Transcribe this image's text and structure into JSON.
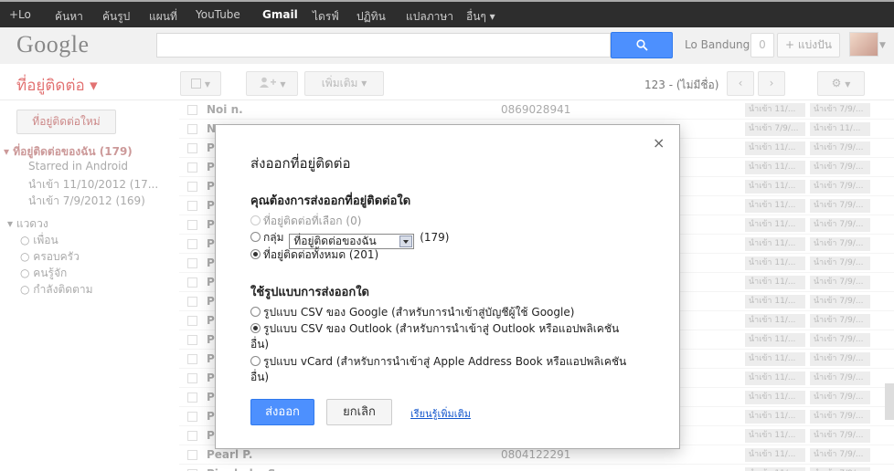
{
  "topbar": {
    "items": [
      "+Lo",
      "ค้นหา",
      "ค้นรูป",
      "แผนที่",
      "YouTube",
      "Gmail",
      "ไดรฟ์",
      "ปฏิทิน",
      "แปลภาษา",
      "อื่นๆ ▾"
    ],
    "active_index": 5
  },
  "header": {
    "logo": "Google",
    "user_name": "Lo Bandung",
    "notification_count": "0",
    "share_label": "+ แบ่งปัน"
  },
  "toolbar": {
    "title": "ที่อยู่ติดต่อ ▾",
    "more_label": "เพิ่มเติม ▾",
    "page_info": "123 - (ไม่มีชื่อ)"
  },
  "sidebar": {
    "new_contact": "ที่อยู่ติดต่อใหม่",
    "my_contacts": "▾ ที่อยู่ติดต่อของฉัน (179)",
    "sub_items": [
      "Starred in Android",
      "นำเข้า 11/10/2012 (17...",
      "นำเข้า 7/9/2012 (169)"
    ],
    "circles_header": "▾ แวดวง",
    "circles": [
      "เพื่อน",
      "ครอบครัว",
      "คนรู้จัก",
      "กำลังติดตาม"
    ]
  },
  "contacts": [
    {
      "name": "Noi n.",
      "phone": "0869028941",
      "g1": "นำเข้า 11/...",
      "g2": "นำเข้า 7/9/..."
    },
    {
      "name": "N",
      "phone": "",
      "g1": "นำเข้า 7/9/...",
      "g2": "นำเข้า 11/..."
    },
    {
      "name": "P",
      "phone": "",
      "g1": "นำเข้า 11/...",
      "g2": "นำเข้า 7/9/..."
    },
    {
      "name": "P",
      "phone": "",
      "g1": "นำเข้า 11/...",
      "g2": "นำเข้า 7/9/..."
    },
    {
      "name": "P",
      "phone": "",
      "g1": "นำเข้า 11/...",
      "g2": "นำเข้า 7/9/..."
    },
    {
      "name": "P",
      "phone": "",
      "g1": "นำเข้า 11/...",
      "g2": "นำเข้า 7/9/..."
    },
    {
      "name": "P",
      "phone": "",
      "g1": "นำเข้า 11/...",
      "g2": "นำเข้า 7/9/..."
    },
    {
      "name": "P",
      "phone": "",
      "g1": "นำเข้า 11/...",
      "g2": "นำเข้า 7/9/..."
    },
    {
      "name": "P",
      "phone": "",
      "g1": "นำเข้า 11/...",
      "g2": "นำเข้า 7/9/..."
    },
    {
      "name": "P",
      "phone": "",
      "g1": "นำเข้า 11/...",
      "g2": "นำเข้า 7/9/..."
    },
    {
      "name": "P",
      "phone": "",
      "g1": "นำเข้า 11/...",
      "g2": "นำเข้า 7/9/..."
    },
    {
      "name": "P",
      "phone": "",
      "g1": "นำเข้า 11/...",
      "g2": "นำเข้า 7/9/..."
    },
    {
      "name": "P",
      "phone": "",
      "g1": "นำเข้า 11/...",
      "g2": "นำเข้า 7/9/..."
    },
    {
      "name": "P",
      "phone": "",
      "g1": "นำเข้า 11/...",
      "g2": "นำเข้า 7/9/..."
    },
    {
      "name": "P",
      "phone": "",
      "g1": "นำเข้า 11/...",
      "g2": "นำเข้า 7/9/..."
    },
    {
      "name": "P",
      "phone": "",
      "g1": "นำเข้า 11/...",
      "g2": "นำเข้า 7/9/..."
    },
    {
      "name": "P",
      "phone": "",
      "g1": "นำเข้า 11/...",
      "g2": "นำเข้า 7/9/..."
    },
    {
      "name": "P",
      "phone": "",
      "g1": "นำเข้า 11/...",
      "g2": "นำเข้า 7/9/..."
    },
    {
      "name": "Pearl P.",
      "phone": "0804122291",
      "g1": "นำเข้า 11/...",
      "g2": "นำเข้า 7/9/..."
    },
    {
      "name": "Pinnhaka S.",
      "phone": "",
      "g1": "นำเข้า 11/...",
      "g2": "นำเข้า 7/9/..."
    }
  ],
  "dialog": {
    "close": "×",
    "title": "ส่งออกที่อยู่ติดต่อ",
    "q1": "คุณต้องการส่งออกที่อยู่ติดต่อใด",
    "opt_selected": "ที่อยู่ติดต่อที่เลือก (0)",
    "opt_group_prefix": "กลุ่ม",
    "group_value": "ที่อยู่ติดต่อของฉัน",
    "group_count": "(179)",
    "opt_all": "ที่อยู่ติดต่อทั้งหมด (201)",
    "q2": "ใช้รูปแบบการส่งออกใด",
    "fmt_google": "รูปแบบ CSV ของ Google (สำหรับการนำเข้าสู่บัญชีผู้ใช้ Google)",
    "fmt_outlook_1": "รูปแบบ CSV ของ Outlook (สำหรับการนำเข้าสู่ Outlook หรือแอปพลิเคชัน",
    "fmt_outlook_2": "อื่น)",
    "fmt_vcard_1": "รูปแบบ vCard (สำหรับการนำเข้าสู่ Apple Address Book หรือแอปพลิเคชัน",
    "fmt_vcard_2": "อื่น)",
    "export": "ส่งออก",
    "cancel": "ยกเลิก",
    "learn_more": "เรียนรู้เพิ่มเติม"
  },
  "colors": {
    "accent": "#4d90fe",
    "topbar_bg": "#2d2d2d",
    "link": "#1155cc"
  }
}
